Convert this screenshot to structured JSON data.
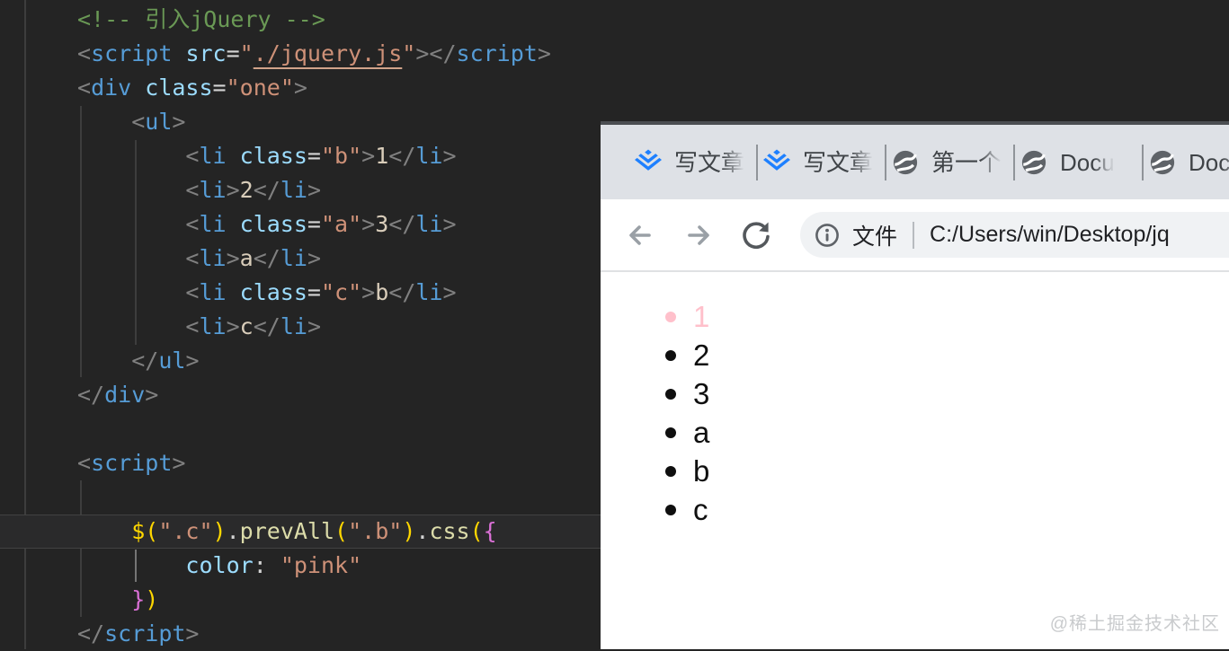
{
  "colors": {
    "accent_pink": "#ffc0cb",
    "juejin_blue": "#1e80ff",
    "string_orange": "#ce9178",
    "tag_blue": "#569cd6",
    "attr_blue": "#9cdcfe",
    "comment_green": "#6a9955",
    "bracket_gold": "#ffd700",
    "bracket_orchid": "#da70d6",
    "globe_gray": "#5f6368"
  },
  "editor": {
    "active_line_index": 15,
    "lines": [
      {
        "tokens": [
          [
            "comment",
            "<!-- 引入jQuery -->"
          ]
        ]
      },
      {
        "tokens": [
          [
            "p",
            "<"
          ],
          [
            "tag",
            "script"
          ],
          [
            "plain",
            " "
          ],
          [
            "attr",
            "src"
          ],
          [
            "op",
            "="
          ],
          [
            "str",
            "\""
          ],
          [
            "strlink",
            "./jquery.js"
          ],
          [
            "str",
            "\""
          ],
          [
            "p",
            "></"
          ],
          [
            "tag",
            "script"
          ],
          [
            "p",
            ">"
          ]
        ]
      },
      {
        "tokens": [
          [
            "p",
            "<"
          ],
          [
            "tag",
            "div"
          ],
          [
            "plain",
            " "
          ],
          [
            "attr",
            "class"
          ],
          [
            "op",
            "="
          ],
          [
            "str",
            "\"one\""
          ],
          [
            "p",
            ">"
          ]
        ]
      },
      {
        "tokens": [
          [
            "plain",
            "    "
          ],
          [
            "p",
            "<"
          ],
          [
            "tag",
            "ul"
          ],
          [
            "p",
            ">"
          ]
        ]
      },
      {
        "tokens": [
          [
            "plain",
            "        "
          ],
          [
            "p",
            "<"
          ],
          [
            "tag",
            "li"
          ],
          [
            "plain",
            " "
          ],
          [
            "attr",
            "class"
          ],
          [
            "op",
            "="
          ],
          [
            "str",
            "\"b\""
          ],
          [
            "p",
            ">"
          ],
          [
            "txt",
            "1"
          ],
          [
            "p",
            "</"
          ],
          [
            "tag",
            "li"
          ],
          [
            "p",
            ">"
          ]
        ]
      },
      {
        "tokens": [
          [
            "plain",
            "        "
          ],
          [
            "p",
            "<"
          ],
          [
            "tag",
            "li"
          ],
          [
            "p",
            ">"
          ],
          [
            "txt",
            "2"
          ],
          [
            "p",
            "</"
          ],
          [
            "tag",
            "li"
          ],
          [
            "p",
            ">"
          ]
        ]
      },
      {
        "tokens": [
          [
            "plain",
            "        "
          ],
          [
            "p",
            "<"
          ],
          [
            "tag",
            "li"
          ],
          [
            "plain",
            " "
          ],
          [
            "attr",
            "class"
          ],
          [
            "op",
            "="
          ],
          [
            "str",
            "\"a\""
          ],
          [
            "p",
            ">"
          ],
          [
            "txt",
            "3"
          ],
          [
            "p",
            "</"
          ],
          [
            "tag",
            "li"
          ],
          [
            "p",
            ">"
          ]
        ]
      },
      {
        "tokens": [
          [
            "plain",
            "        "
          ],
          [
            "p",
            "<"
          ],
          [
            "tag",
            "li"
          ],
          [
            "p",
            ">"
          ],
          [
            "txt",
            "a"
          ],
          [
            "p",
            "</"
          ],
          [
            "tag",
            "li"
          ],
          [
            "p",
            ">"
          ]
        ]
      },
      {
        "tokens": [
          [
            "plain",
            "        "
          ],
          [
            "p",
            "<"
          ],
          [
            "tag",
            "li"
          ],
          [
            "plain",
            " "
          ],
          [
            "attr",
            "class"
          ],
          [
            "op",
            "="
          ],
          [
            "str",
            "\"c\""
          ],
          [
            "p",
            ">"
          ],
          [
            "txt",
            "b"
          ],
          [
            "p",
            "</"
          ],
          [
            "tag",
            "li"
          ],
          [
            "p",
            ">"
          ]
        ]
      },
      {
        "tokens": [
          [
            "plain",
            "        "
          ],
          [
            "p",
            "<"
          ],
          [
            "tag",
            "li"
          ],
          [
            "p",
            ">"
          ],
          [
            "txt",
            "c"
          ],
          [
            "p",
            "</"
          ],
          [
            "tag",
            "li"
          ],
          [
            "p",
            ">"
          ]
        ]
      },
      {
        "tokens": [
          [
            "plain",
            "    "
          ],
          [
            "p",
            "</"
          ],
          [
            "tag",
            "ul"
          ],
          [
            "p",
            ">"
          ]
        ]
      },
      {
        "tokens": [
          [
            "p",
            "</"
          ],
          [
            "tag",
            "div"
          ],
          [
            "p",
            ">"
          ]
        ]
      },
      {
        "tokens": []
      },
      {
        "tokens": [
          [
            "p",
            "<"
          ],
          [
            "tag",
            "script"
          ],
          [
            "p",
            ">"
          ]
        ]
      },
      {
        "tokens": []
      },
      {
        "tokens": [
          [
            "plain",
            "    "
          ],
          [
            "b1",
            "$("
          ],
          [
            "str",
            "\".c\""
          ],
          [
            "b1",
            ")"
          ],
          [
            "op",
            "."
          ],
          [
            "fn",
            "prevAll"
          ],
          [
            "b1",
            "("
          ],
          [
            "str",
            "\".b\""
          ],
          [
            "b1",
            ")"
          ],
          [
            "op",
            "."
          ],
          [
            "fn",
            "css"
          ],
          [
            "b1",
            "("
          ],
          [
            "b2",
            "{"
          ]
        ]
      },
      {
        "tokens": [
          [
            "plain",
            "        "
          ],
          [
            "attr",
            "color"
          ],
          [
            "op",
            ":"
          ],
          [
            "plain",
            " "
          ],
          [
            "str",
            "\"pink\""
          ]
        ]
      },
      {
        "tokens": [
          [
            "plain",
            "    "
          ],
          [
            "b2",
            "}"
          ],
          [
            "b1",
            ")"
          ]
        ]
      },
      {
        "tokens": [
          [
            "p",
            "</"
          ],
          [
            "tag",
            "script"
          ],
          [
            "p",
            ">"
          ]
        ]
      }
    ]
  },
  "browser": {
    "tabs": [
      {
        "icon": "juejin-icon",
        "label": "写文章"
      },
      {
        "icon": "juejin-icon",
        "label": "写文章"
      },
      {
        "icon": "globe-icon",
        "label": "第一个"
      },
      {
        "icon": "globe-icon",
        "label": "Docu"
      },
      {
        "icon": "globe-icon",
        "label": "Docu"
      }
    ],
    "toolbar": {
      "scheme_label": "文件",
      "url": "C:/Users/win/Desktop/jq"
    },
    "page": {
      "list": [
        {
          "text": "1",
          "color": "#ffc0cb"
        },
        {
          "text": "2"
        },
        {
          "text": "3"
        },
        {
          "text": "a"
        },
        {
          "text": "b"
        },
        {
          "text": "c"
        }
      ]
    },
    "watermark": "@稀土掘金技术社区"
  }
}
